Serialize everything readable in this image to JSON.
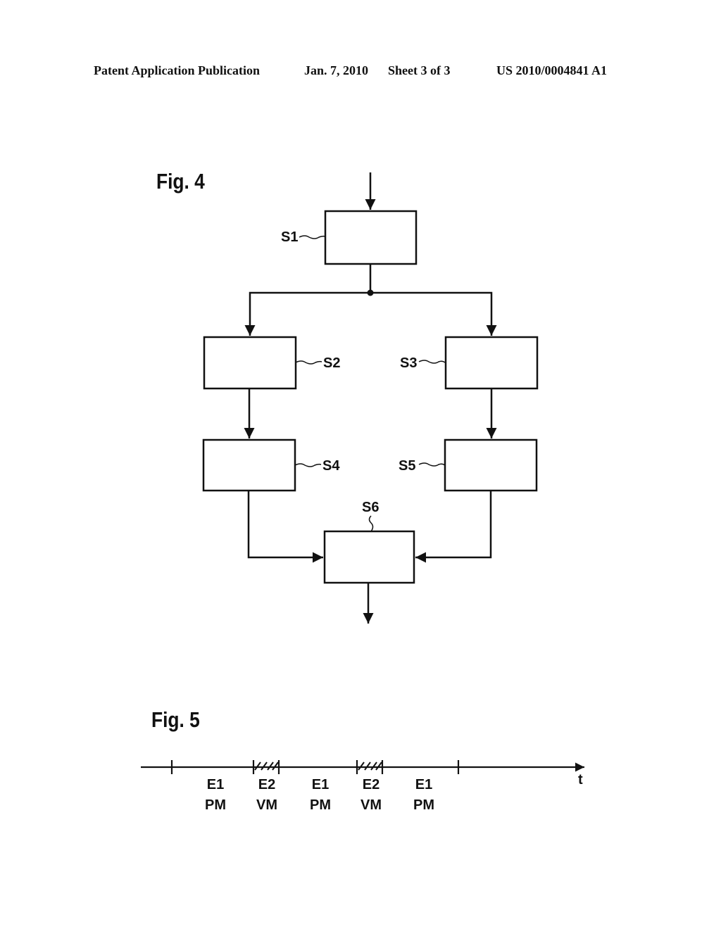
{
  "header": {
    "publication": "Patent Application Publication",
    "date": "Jan. 7, 2010",
    "sheet": "Sheet 3 of 3",
    "number": "US 2010/0004841 A1"
  },
  "fig4": {
    "title": "Fig. 4",
    "steps": [
      {
        "id": "S1",
        "label": "S1"
      },
      {
        "id": "S2",
        "label": "S2"
      },
      {
        "id": "S3",
        "label": "S3"
      },
      {
        "id": "S4",
        "label": "S4"
      },
      {
        "id": "S5",
        "label": "S5"
      },
      {
        "id": "S6",
        "label": "S6"
      }
    ],
    "flow": [
      [
        "input",
        "S1"
      ],
      [
        "S1",
        "S2"
      ],
      [
        "S1",
        "S3"
      ],
      [
        "S2",
        "S4"
      ],
      [
        "S3",
        "S5"
      ],
      [
        "S4",
        "S6"
      ],
      [
        "S5",
        "S6"
      ],
      [
        "S6",
        "output"
      ]
    ]
  },
  "fig5": {
    "title": "Fig. 5",
    "axis_label": "t",
    "segments": [
      {
        "mode": "E1",
        "type": "PM",
        "hatched": false
      },
      {
        "mode": "E2",
        "type": "VM",
        "hatched": true
      },
      {
        "mode": "E1",
        "type": "PM",
        "hatched": false
      },
      {
        "mode": "E2",
        "type": "VM",
        "hatched": true
      },
      {
        "mode": "E1",
        "type": "PM",
        "hatched": false
      }
    ]
  }
}
